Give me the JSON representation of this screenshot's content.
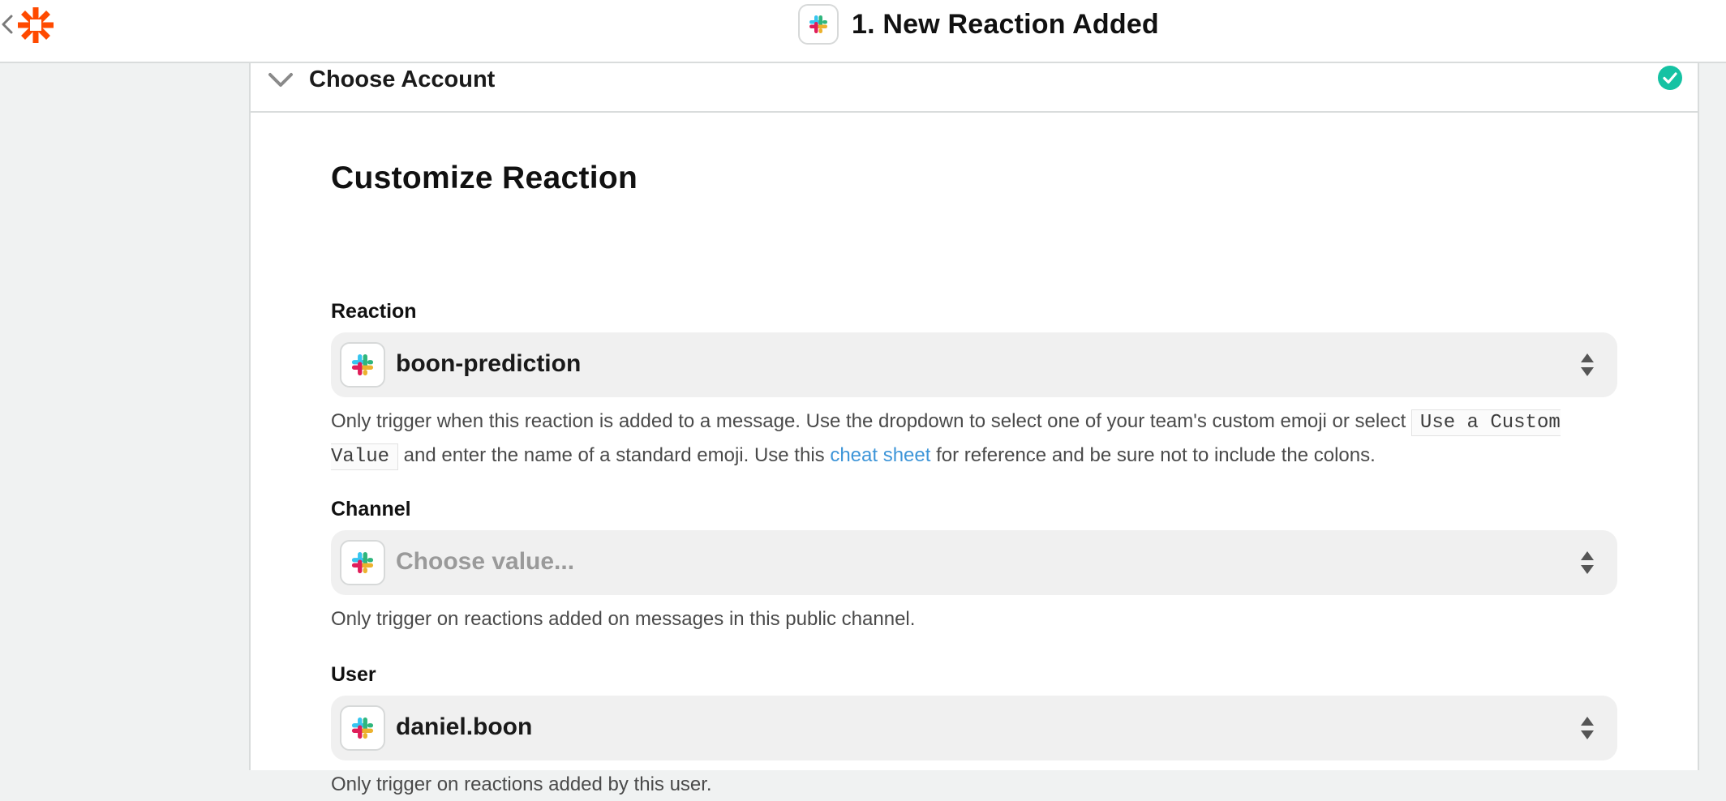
{
  "header": {
    "title": "1. New Reaction Added",
    "app_icon": "slack-icon"
  },
  "section": {
    "title": "Choose Account",
    "status": "complete",
    "status_color": "#15c2a3"
  },
  "form": {
    "title": "Customize Reaction",
    "reaction": {
      "label": "Reaction",
      "value": "boon-prediction",
      "help_before": "Only trigger when this reaction is added to a message. Use the dropdown to select one of your team's custom emoji or select ",
      "help_code": "Use a Custom Value",
      "help_mid": " and enter the name of a standard emoji. Use this ",
      "help_link": "cheat sheet",
      "help_after": " for reference and be sure not to include the colons."
    },
    "channel": {
      "label": "Channel",
      "placeholder": "Choose value...",
      "help": "Only trigger on reactions added on messages in this public channel."
    },
    "user": {
      "label": "User",
      "value": "daniel.boon",
      "help": "Only trigger on reactions added by this user."
    }
  },
  "colors": {
    "brand": "#ff4a00",
    "link": "#3d95d8",
    "field_bg": "#f0f0f0"
  }
}
